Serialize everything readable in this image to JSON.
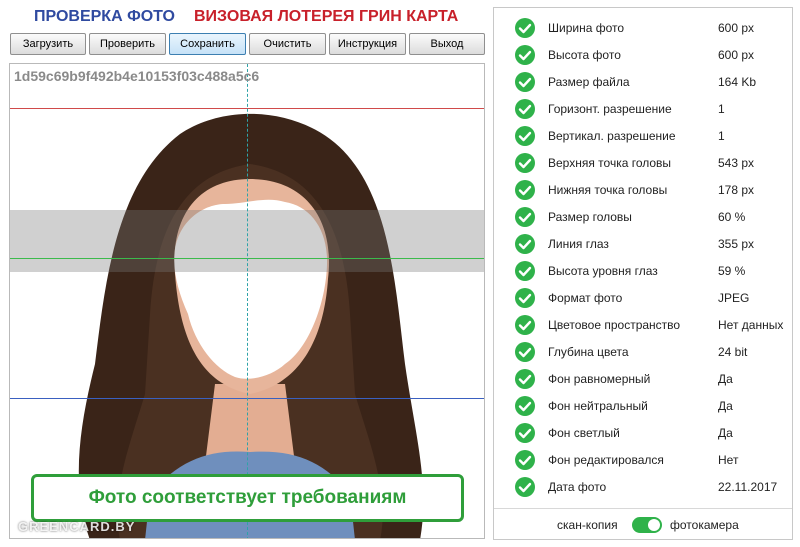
{
  "header": {
    "title_check": "ПРОВЕРКА ФОТО",
    "title_lottery": "ВИЗОВАЯ ЛОТЕРЕЯ ГРИН КАРТА"
  },
  "toolbar": {
    "buttons": [
      {
        "label": "Загрузить"
      },
      {
        "label": "Проверить"
      },
      {
        "label": "Сохранить",
        "active": true
      },
      {
        "label": "Очистить"
      },
      {
        "label": "Инструкция"
      },
      {
        "label": "Выход"
      }
    ]
  },
  "photo": {
    "hash": "1d59c69b9f492b4e10153f03c488a5c6",
    "status": "Фото соответствует требованиям",
    "watermark": "GREENCARD.BY"
  },
  "checks": [
    {
      "label": "Ширина фото",
      "value": "600 px"
    },
    {
      "label": "Высота фото",
      "value": "600 px"
    },
    {
      "label": "Размер файла",
      "value": "164 Kb"
    },
    {
      "label": "Горизонт. разрешение",
      "value": "1"
    },
    {
      "label": "Вертикал. разрешение",
      "value": "1"
    },
    {
      "label": "Верхняя точка головы",
      "value": "543 px"
    },
    {
      "label": "Нижняя точка головы",
      "value": "178 px"
    },
    {
      "label": "Размер головы",
      "value": "60 %"
    },
    {
      "label": "Линия глаз",
      "value": "355 px"
    },
    {
      "label": "Высота уровня глаз",
      "value": "59 %"
    },
    {
      "label": "Формат фото",
      "value": "JPEG"
    },
    {
      "label": "Цветовое пространство",
      "value": "Нет данных"
    },
    {
      "label": "Глубина цвета",
      "value": "24 bit"
    },
    {
      "label": "Фон равномерный",
      "value": "Да"
    },
    {
      "label": "Фон нейтральный",
      "value": "Да"
    },
    {
      "label": "Фон светлый",
      "value": "Да"
    },
    {
      "label": "Фон редактировался",
      "value": "Нет"
    },
    {
      "label": "Дата фото",
      "value": "22.11.2017"
    }
  ],
  "source_switch": {
    "left_label": "скан-копия",
    "right_label": "фотокамера",
    "state": "фотокамера"
  },
  "colors": {
    "accent_green": "#2fb24a",
    "title_blue": "#2f4aa0",
    "title_red": "#c8202a"
  }
}
